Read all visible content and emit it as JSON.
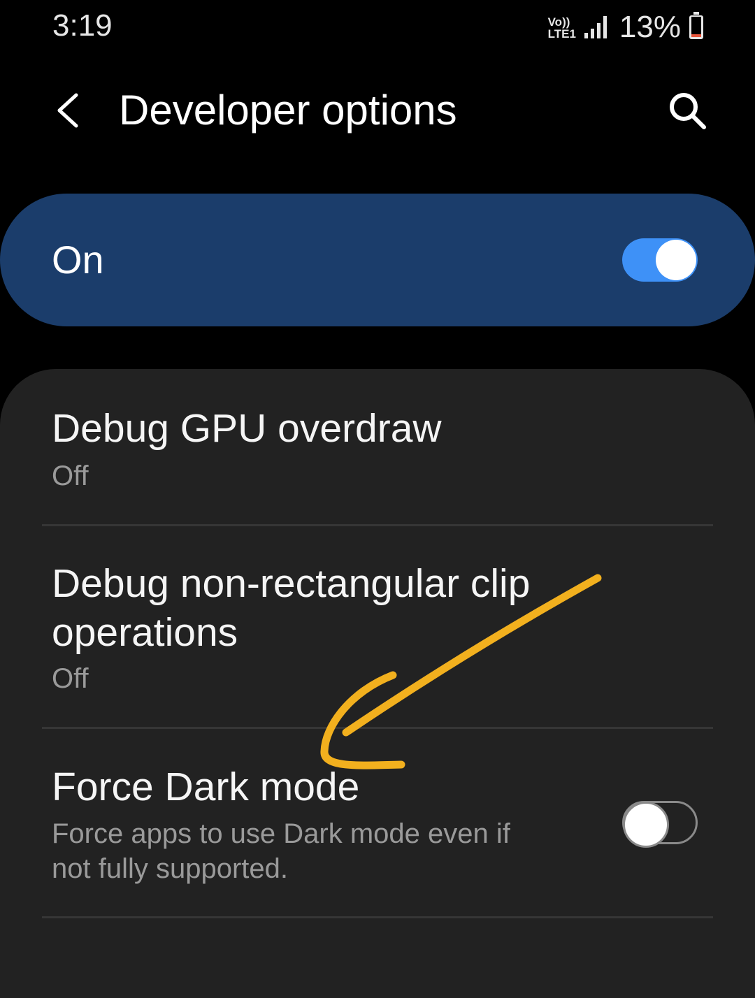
{
  "status_bar": {
    "time": "3:19",
    "network_top": "Vo))",
    "network_bottom": "LTE1",
    "battery_percent": "13%",
    "battery_level": 0.13,
    "battery_color": "#e8563d",
    "icons": [
      "volte-icon",
      "signal-icon",
      "battery-icon"
    ]
  },
  "app_bar": {
    "title": "Developer options",
    "back_icon": "chevron-left-icon",
    "search_icon": "search-icon"
  },
  "master_switch": {
    "label": "On",
    "enabled": true,
    "background_color": "#1b3d6b",
    "accent_color": "#3e91f7"
  },
  "settings": [
    {
      "title": "Debug GPU overdraw",
      "summary": "Off",
      "has_toggle": false
    },
    {
      "title": "Debug non-rectangular clip operations",
      "summary": "Off",
      "has_toggle": false
    },
    {
      "title": "Force Dark mode",
      "summary": "Force apps to use Dark mode even if not fully supported.",
      "has_toggle": true,
      "enabled": false
    }
  ],
  "annotation": {
    "type": "hand-drawn-arrow",
    "color": "#f2b01e"
  }
}
